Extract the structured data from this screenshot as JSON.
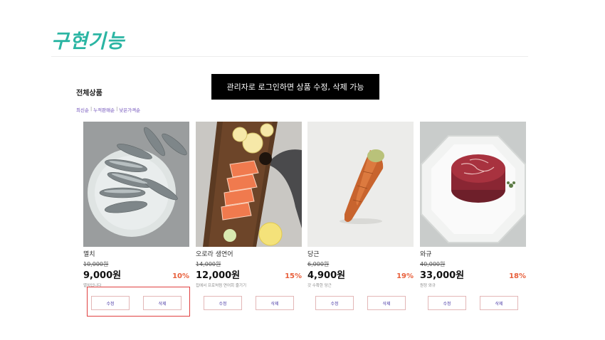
{
  "slide": {
    "title": "구현기능"
  },
  "callout": {
    "text": "관리자로 로그인하면 상품 수정, 삭제 가능"
  },
  "section": {
    "title": "전체상품"
  },
  "sort": {
    "options": [
      "최신순",
      "누적판매순",
      "낮은가격순"
    ],
    "separator": "|"
  },
  "products": [
    {
      "name": "멸치",
      "original_price": "10,000원",
      "price": "9,000원",
      "discount": "10%",
      "description": "멸치입니다",
      "edit_label": "수정",
      "delete_label": "삭제"
    },
    {
      "name": "오로라 생연어",
      "original_price": "14,000원",
      "price": "12,000원",
      "discount": "15%",
      "description": "집에서 프로처럼 연어회 즐기기",
      "edit_label": "수정",
      "delete_label": "삭제"
    },
    {
      "name": "당근",
      "original_price": "6,000원",
      "price": "4,900원",
      "discount": "19%",
      "description": "갓 수확한 당근",
      "edit_label": "수정",
      "delete_label": "삭제"
    },
    {
      "name": "와규",
      "original_price": "40,000원",
      "price": "33,000원",
      "discount": "18%",
      "description": "원정 와규",
      "edit_label": "수정",
      "delete_label": "삭제"
    }
  ],
  "colors": {
    "title": "#2bb5a3",
    "discount": "#e8603c",
    "highlight": "#e04040",
    "button_text": "#4a3aa6"
  }
}
